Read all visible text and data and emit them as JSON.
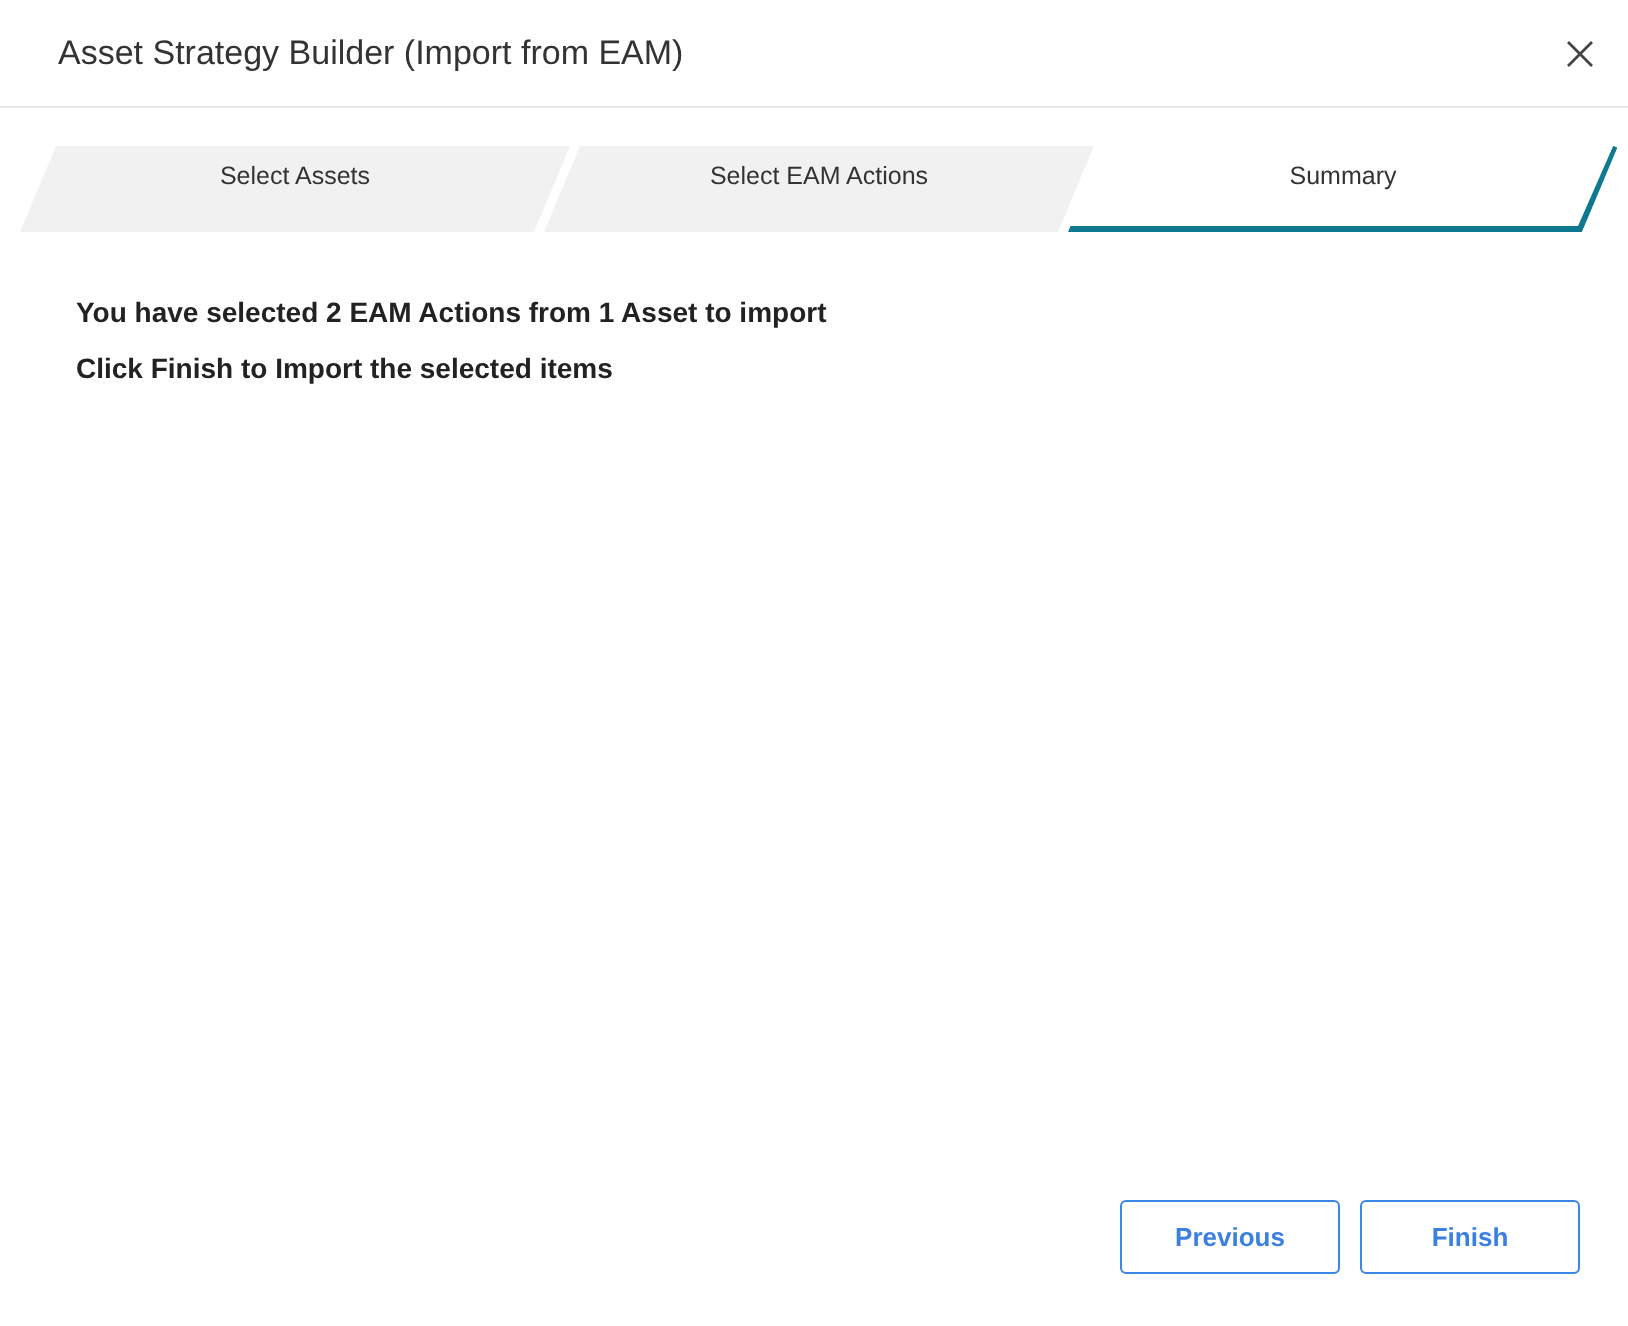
{
  "dialog": {
    "title": "Asset Strategy Builder (Import from EAM)"
  },
  "steps": [
    {
      "label": "Select Assets",
      "selected": false
    },
    {
      "label": "Select EAM Actions",
      "selected": false
    },
    {
      "label": "Summary",
      "selected": true
    }
  ],
  "summary": [
    "You have selected 2 EAM Actions from 1 Asset to import",
    "Click Finish to Import the selected items"
  ],
  "buttons": [
    "Previous",
    "Finish"
  ]
}
